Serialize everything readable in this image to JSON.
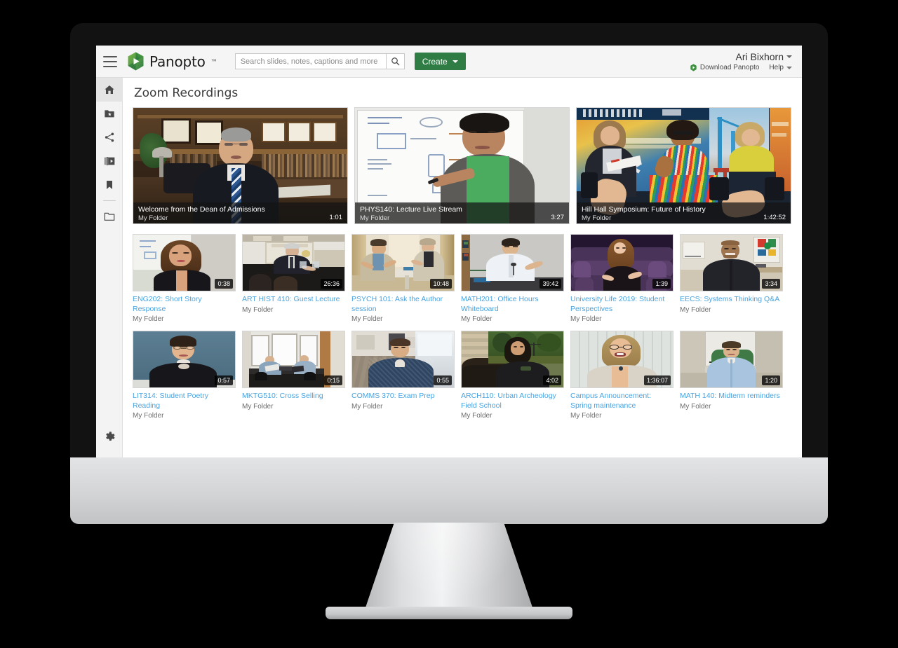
{
  "topbar": {
    "menu_icon": "hamburger-icon",
    "brand_name": "Panopto",
    "brand_tm": "™",
    "search_placeholder": "Search slides, notes, captions and more",
    "search_value": "",
    "search_icon": "search-icon",
    "create_label": "Create",
    "user_name": "Ari Bixhorn",
    "download_label": "Download Panopto",
    "help_label": "Help"
  },
  "sidebar": {
    "items": [
      {
        "name": "home",
        "icon": "home-icon",
        "active": true
      },
      {
        "name": "my-folder",
        "icon": "folder-star-icon",
        "active": false
      },
      {
        "name": "shared-with-me",
        "icon": "share-icon",
        "active": false
      },
      {
        "name": "my-videos",
        "icon": "video-library-icon",
        "active": false
      },
      {
        "name": "bookmarks",
        "icon": "bookmark-icon",
        "active": false
      },
      {
        "name": "browse-folders",
        "icon": "folder-icon",
        "active": false
      }
    ],
    "settings_icon": "gear-icon"
  },
  "main": {
    "page_title": "Zoom Recordings",
    "folder_label": "My Folder",
    "featured": [
      {
        "title": "Welcome from the Dean of Admissions",
        "folder": "My Folder",
        "duration": "1:01",
        "scene": "dean"
      },
      {
        "title": "PHYS140: Lecture Live Stream",
        "folder": "My Folder",
        "duration": "3:27",
        "scene": "whiteboard"
      },
      {
        "title": "Hill Hall Symposium: Future of History",
        "folder": "My Folder",
        "duration": "1:42:52",
        "scene": "panel"
      }
    ],
    "grid_rows": [
      [
        {
          "title": "ENG202: Short Story Response",
          "folder": "My Folder",
          "duration": "0:38",
          "scene": "woman-whiteboard"
        },
        {
          "title": "ART HIST 410: Guest Lecture",
          "folder": "My Folder",
          "duration": "26:36",
          "scene": "lecture-hall-suit"
        },
        {
          "title": "PSYCH 101: Ask the Author session",
          "folder": "My Folder",
          "duration": "10:48",
          "scene": "two-hosts"
        },
        {
          "title": "MATH201: Office Hours Whiteboard",
          "folder": "My Folder",
          "duration": "39:42",
          "scene": "man-classroom"
        },
        {
          "title": "University Life 2019: Student Perspectives",
          "folder": "My Folder",
          "duration": "1:39",
          "scene": "auditorium"
        },
        {
          "title": "EECS: Systems Thinking Q&A",
          "folder": "My Folder",
          "duration": "3:34",
          "scene": "man-office-art"
        }
      ],
      [
        {
          "title": "LIT314: Student Poetry Reading",
          "folder": "My Folder",
          "duration": "0:57",
          "scene": "student-blue"
        },
        {
          "title": "MKTG510: Cross Selling",
          "folder": "My Folder",
          "duration": "0:15",
          "scene": "meeting-room"
        },
        {
          "title": "COMMS 370: Exam Prep",
          "folder": "My Folder",
          "duration": "0:55",
          "scene": "man-hallway"
        },
        {
          "title": "ARCH110: Urban Archeology Field School",
          "folder": "My Folder",
          "duration": "4:02",
          "scene": "field-dig"
        },
        {
          "title": "Campus Announcement: Spring maintenance",
          "folder": "My Folder",
          "duration": "1:36:07",
          "scene": "woman-glasses"
        },
        {
          "title": "MATH 140: Midterm reminders",
          "folder": "My Folder",
          "duration": "1:20",
          "scene": "man-greenchair"
        }
      ]
    ]
  },
  "colors": {
    "brand_green": "#2f7d45",
    "link_blue": "#4aa3df",
    "topbar_bg": "#f5f5f5",
    "sidebar_bg": "#f3f3f3",
    "bezel": "#121212",
    "chin": "#d3d4d6"
  }
}
